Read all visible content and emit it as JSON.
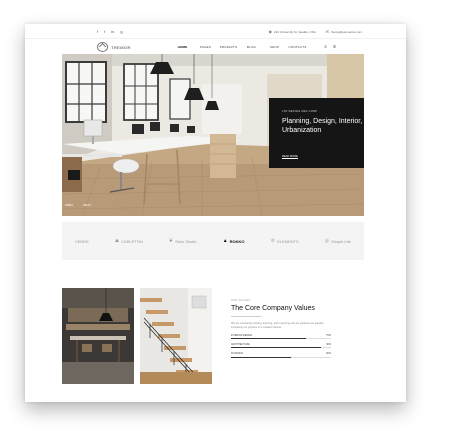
{
  "topbar": {
    "social": [
      "f",
      "t",
      "in",
      "g"
    ],
    "address": "222 University St, Seattle, USA",
    "email": "theme@elementor.com"
  },
  "header": {
    "logo_text": "TREMOR",
    "nav": [
      "HOME",
      "PAGES",
      "PROJECTS",
      "BLOG",
      "SHOP",
      "CONTACTS"
    ],
    "icons": [
      "search-icon",
      "menu-icon"
    ]
  },
  "hero": {
    "kicker": "LTD DESIGN AND CORP",
    "title": "Planning, Design, Interior, Urbanization",
    "link": "READ MORE",
    "prev": "PREV",
    "next": "NEXT"
  },
  "brands": [
    {
      "name": "VENDE",
      "icon": ""
    },
    {
      "name": "CARLETON",
      "icon": "mountain-icon"
    },
    {
      "name": "Stein Studio",
      "icon": "leaf-icon"
    },
    {
      "name": "ROKKO",
      "icon": "triangle-icon"
    },
    {
      "name": "ELEMENTS",
      "icon": "crown-icon"
    },
    {
      "name": "Simple Life",
      "icon": "circle-icon"
    }
  ],
  "values": {
    "kicker": "OUR VALUES",
    "title": "The Core Company Values",
    "text": "We are constantly growing, learning, and improving and our partners are steadily increasing our projects in a creative manner.",
    "skills": [
      {
        "label": "INTERIOR DESIGN",
        "value": 75,
        "display": "75%"
      },
      {
        "label": "ARCHITECTURE",
        "value": 90,
        "display": "90%"
      },
      {
        "label": "PLANNING",
        "value": 60,
        "display": "60%"
      }
    ]
  },
  "colors": {
    "dark": "#151515",
    "accent_bg": "#f4f4f4"
  }
}
